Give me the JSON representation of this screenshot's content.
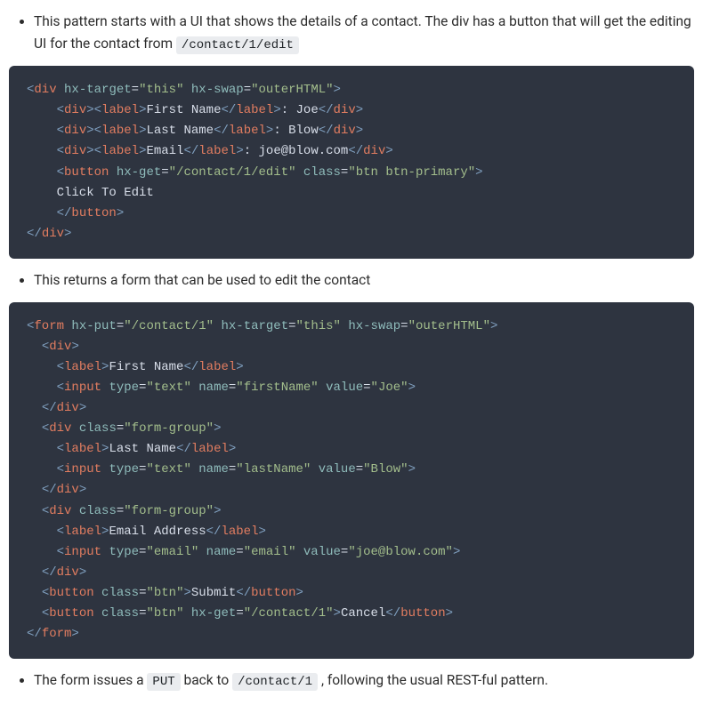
{
  "bullets": {
    "b1_a": "This pattern starts with a UI that shows the details of a contact. The div has a button that will get the editing UI for the contact from ",
    "b1_code": "/contact/1/edit",
    "b2": "This returns a form that can be used to edit the contact",
    "b3_a": "The form issues a ",
    "b3_code1": "PUT",
    "b3_b": " back to ",
    "b3_code2": "/contact/1",
    "b3_c": " , following the usual REST-ful pattern."
  },
  "code1": {
    "lines": [
      [
        {
          "c": "t-tag",
          "t": "<"
        },
        {
          "c": "t-name",
          "t": "div"
        },
        {
          "c": "t-txt",
          "t": " "
        },
        {
          "c": "t-attr",
          "t": "hx-target"
        },
        {
          "c": "t-op",
          "t": "="
        },
        {
          "c": "t-str",
          "t": "\"this\""
        },
        {
          "c": "t-txt",
          "t": " "
        },
        {
          "c": "t-attr",
          "t": "hx-swap"
        },
        {
          "c": "t-op",
          "t": "="
        },
        {
          "c": "t-str",
          "t": "\"outerHTML\""
        },
        {
          "c": "t-tag",
          "t": ">"
        }
      ],
      [
        {
          "c": "t-txt",
          "t": "    "
        },
        {
          "c": "t-tag",
          "t": "<"
        },
        {
          "c": "t-name",
          "t": "div"
        },
        {
          "c": "t-tag",
          "t": ">"
        },
        {
          "c": "t-tag",
          "t": "<"
        },
        {
          "c": "t-name",
          "t": "label"
        },
        {
          "c": "t-tag",
          "t": ">"
        },
        {
          "c": "t-txt",
          "t": "First Name"
        },
        {
          "c": "t-tag",
          "t": "</"
        },
        {
          "c": "t-name",
          "t": "label"
        },
        {
          "c": "t-tag",
          "t": ">"
        },
        {
          "c": "t-txt",
          "t": ": Joe"
        },
        {
          "c": "t-tag",
          "t": "</"
        },
        {
          "c": "t-name",
          "t": "div"
        },
        {
          "c": "t-tag",
          "t": ">"
        }
      ],
      [
        {
          "c": "t-txt",
          "t": "    "
        },
        {
          "c": "t-tag",
          "t": "<"
        },
        {
          "c": "t-name",
          "t": "div"
        },
        {
          "c": "t-tag",
          "t": ">"
        },
        {
          "c": "t-tag",
          "t": "<"
        },
        {
          "c": "t-name",
          "t": "label"
        },
        {
          "c": "t-tag",
          "t": ">"
        },
        {
          "c": "t-txt",
          "t": "Last Name"
        },
        {
          "c": "t-tag",
          "t": "</"
        },
        {
          "c": "t-name",
          "t": "label"
        },
        {
          "c": "t-tag",
          "t": ">"
        },
        {
          "c": "t-txt",
          "t": ": Blow"
        },
        {
          "c": "t-tag",
          "t": "</"
        },
        {
          "c": "t-name",
          "t": "div"
        },
        {
          "c": "t-tag",
          "t": ">"
        }
      ],
      [
        {
          "c": "t-txt",
          "t": "    "
        },
        {
          "c": "t-tag",
          "t": "<"
        },
        {
          "c": "t-name",
          "t": "div"
        },
        {
          "c": "t-tag",
          "t": ">"
        },
        {
          "c": "t-tag",
          "t": "<"
        },
        {
          "c": "t-name",
          "t": "label"
        },
        {
          "c": "t-tag",
          "t": ">"
        },
        {
          "c": "t-txt",
          "t": "Email"
        },
        {
          "c": "t-tag",
          "t": "</"
        },
        {
          "c": "t-name",
          "t": "label"
        },
        {
          "c": "t-tag",
          "t": ">"
        },
        {
          "c": "t-txt",
          "t": ": joe@blow.com"
        },
        {
          "c": "t-tag",
          "t": "</"
        },
        {
          "c": "t-name",
          "t": "div"
        },
        {
          "c": "t-tag",
          "t": ">"
        }
      ],
      [
        {
          "c": "t-txt",
          "t": "    "
        },
        {
          "c": "t-tag",
          "t": "<"
        },
        {
          "c": "t-name",
          "t": "button"
        },
        {
          "c": "t-txt",
          "t": " "
        },
        {
          "c": "t-attr",
          "t": "hx-get"
        },
        {
          "c": "t-op",
          "t": "="
        },
        {
          "c": "t-str",
          "t": "\"/contact/1/edit\""
        },
        {
          "c": "t-txt",
          "t": " "
        },
        {
          "c": "t-attr",
          "t": "class"
        },
        {
          "c": "t-op",
          "t": "="
        },
        {
          "c": "t-str",
          "t": "\"btn btn-primary\""
        },
        {
          "c": "t-tag",
          "t": ">"
        }
      ],
      [
        {
          "c": "t-txt",
          "t": "    Click To Edit"
        }
      ],
      [
        {
          "c": "t-txt",
          "t": "    "
        },
        {
          "c": "t-tag",
          "t": "</"
        },
        {
          "c": "t-name",
          "t": "button"
        },
        {
          "c": "t-tag",
          "t": ">"
        }
      ],
      [
        {
          "c": "t-tag",
          "t": "</"
        },
        {
          "c": "t-name",
          "t": "div"
        },
        {
          "c": "t-tag",
          "t": ">"
        }
      ]
    ]
  },
  "code2": {
    "lines": [
      [
        {
          "c": "t-tag",
          "t": "<"
        },
        {
          "c": "t-name",
          "t": "form"
        },
        {
          "c": "t-txt",
          "t": " "
        },
        {
          "c": "t-attr",
          "t": "hx-put"
        },
        {
          "c": "t-op",
          "t": "="
        },
        {
          "c": "t-str",
          "t": "\"/contact/1\""
        },
        {
          "c": "t-txt",
          "t": " "
        },
        {
          "c": "t-attr",
          "t": "hx-target"
        },
        {
          "c": "t-op",
          "t": "="
        },
        {
          "c": "t-str",
          "t": "\"this\""
        },
        {
          "c": "t-txt",
          "t": " "
        },
        {
          "c": "t-attr",
          "t": "hx-swap"
        },
        {
          "c": "t-op",
          "t": "="
        },
        {
          "c": "t-str",
          "t": "\"outerHTML\""
        },
        {
          "c": "t-tag",
          "t": ">"
        }
      ],
      [
        {
          "c": "t-txt",
          "t": "  "
        },
        {
          "c": "t-tag",
          "t": "<"
        },
        {
          "c": "t-name",
          "t": "div"
        },
        {
          "c": "t-tag",
          "t": ">"
        }
      ],
      [
        {
          "c": "t-txt",
          "t": "    "
        },
        {
          "c": "t-tag",
          "t": "<"
        },
        {
          "c": "t-name",
          "t": "label"
        },
        {
          "c": "t-tag",
          "t": ">"
        },
        {
          "c": "t-txt",
          "t": "First Name"
        },
        {
          "c": "t-tag",
          "t": "</"
        },
        {
          "c": "t-name",
          "t": "label"
        },
        {
          "c": "t-tag",
          "t": ">"
        }
      ],
      [
        {
          "c": "t-txt",
          "t": "    "
        },
        {
          "c": "t-tag",
          "t": "<"
        },
        {
          "c": "t-name",
          "t": "input"
        },
        {
          "c": "t-txt",
          "t": " "
        },
        {
          "c": "t-attr",
          "t": "type"
        },
        {
          "c": "t-op",
          "t": "="
        },
        {
          "c": "t-str",
          "t": "\"text\""
        },
        {
          "c": "t-txt",
          "t": " "
        },
        {
          "c": "t-attr",
          "t": "name"
        },
        {
          "c": "t-op",
          "t": "="
        },
        {
          "c": "t-str",
          "t": "\"firstName\""
        },
        {
          "c": "t-txt",
          "t": " "
        },
        {
          "c": "t-attr",
          "t": "value"
        },
        {
          "c": "t-op",
          "t": "="
        },
        {
          "c": "t-str",
          "t": "\"Joe\""
        },
        {
          "c": "t-tag",
          "t": ">"
        }
      ],
      [
        {
          "c": "t-txt",
          "t": "  "
        },
        {
          "c": "t-tag",
          "t": "</"
        },
        {
          "c": "t-name",
          "t": "div"
        },
        {
          "c": "t-tag",
          "t": ">"
        }
      ],
      [
        {
          "c": "t-txt",
          "t": "  "
        },
        {
          "c": "t-tag",
          "t": "<"
        },
        {
          "c": "t-name",
          "t": "div"
        },
        {
          "c": "t-txt",
          "t": " "
        },
        {
          "c": "t-attr",
          "t": "class"
        },
        {
          "c": "t-op",
          "t": "="
        },
        {
          "c": "t-str",
          "t": "\"form-group\""
        },
        {
          "c": "t-tag",
          "t": ">"
        }
      ],
      [
        {
          "c": "t-txt",
          "t": "    "
        },
        {
          "c": "t-tag",
          "t": "<"
        },
        {
          "c": "t-name",
          "t": "label"
        },
        {
          "c": "t-tag",
          "t": ">"
        },
        {
          "c": "t-txt",
          "t": "Last Name"
        },
        {
          "c": "t-tag",
          "t": "</"
        },
        {
          "c": "t-name",
          "t": "label"
        },
        {
          "c": "t-tag",
          "t": ">"
        }
      ],
      [
        {
          "c": "t-txt",
          "t": "    "
        },
        {
          "c": "t-tag",
          "t": "<"
        },
        {
          "c": "t-name",
          "t": "input"
        },
        {
          "c": "t-txt",
          "t": " "
        },
        {
          "c": "t-attr",
          "t": "type"
        },
        {
          "c": "t-op",
          "t": "="
        },
        {
          "c": "t-str",
          "t": "\"text\""
        },
        {
          "c": "t-txt",
          "t": " "
        },
        {
          "c": "t-attr",
          "t": "name"
        },
        {
          "c": "t-op",
          "t": "="
        },
        {
          "c": "t-str",
          "t": "\"lastName\""
        },
        {
          "c": "t-txt",
          "t": " "
        },
        {
          "c": "t-attr",
          "t": "value"
        },
        {
          "c": "t-op",
          "t": "="
        },
        {
          "c": "t-str",
          "t": "\"Blow\""
        },
        {
          "c": "t-tag",
          "t": ">"
        }
      ],
      [
        {
          "c": "t-txt",
          "t": "  "
        },
        {
          "c": "t-tag",
          "t": "</"
        },
        {
          "c": "t-name",
          "t": "div"
        },
        {
          "c": "t-tag",
          "t": ">"
        }
      ],
      [
        {
          "c": "t-txt",
          "t": "  "
        },
        {
          "c": "t-tag",
          "t": "<"
        },
        {
          "c": "t-name",
          "t": "div"
        },
        {
          "c": "t-txt",
          "t": " "
        },
        {
          "c": "t-attr",
          "t": "class"
        },
        {
          "c": "t-op",
          "t": "="
        },
        {
          "c": "t-str",
          "t": "\"form-group\""
        },
        {
          "c": "t-tag",
          "t": ">"
        }
      ],
      [
        {
          "c": "t-txt",
          "t": "    "
        },
        {
          "c": "t-tag",
          "t": "<"
        },
        {
          "c": "t-name",
          "t": "label"
        },
        {
          "c": "t-tag",
          "t": ">"
        },
        {
          "c": "t-txt",
          "t": "Email Address"
        },
        {
          "c": "t-tag",
          "t": "</"
        },
        {
          "c": "t-name",
          "t": "label"
        },
        {
          "c": "t-tag",
          "t": ">"
        }
      ],
      [
        {
          "c": "t-txt",
          "t": "    "
        },
        {
          "c": "t-tag",
          "t": "<"
        },
        {
          "c": "t-name",
          "t": "input"
        },
        {
          "c": "t-txt",
          "t": " "
        },
        {
          "c": "t-attr",
          "t": "type"
        },
        {
          "c": "t-op",
          "t": "="
        },
        {
          "c": "t-str",
          "t": "\"email\""
        },
        {
          "c": "t-txt",
          "t": " "
        },
        {
          "c": "t-attr",
          "t": "name"
        },
        {
          "c": "t-op",
          "t": "="
        },
        {
          "c": "t-str",
          "t": "\"email\""
        },
        {
          "c": "t-txt",
          "t": " "
        },
        {
          "c": "t-attr",
          "t": "value"
        },
        {
          "c": "t-op",
          "t": "="
        },
        {
          "c": "t-str",
          "t": "\"joe@blow.com\""
        },
        {
          "c": "t-tag",
          "t": ">"
        }
      ],
      [
        {
          "c": "t-txt",
          "t": "  "
        },
        {
          "c": "t-tag",
          "t": "</"
        },
        {
          "c": "t-name",
          "t": "div"
        },
        {
          "c": "t-tag",
          "t": ">"
        }
      ],
      [
        {
          "c": "t-txt",
          "t": "  "
        },
        {
          "c": "t-tag",
          "t": "<"
        },
        {
          "c": "t-name",
          "t": "button"
        },
        {
          "c": "t-txt",
          "t": " "
        },
        {
          "c": "t-attr",
          "t": "class"
        },
        {
          "c": "t-op",
          "t": "="
        },
        {
          "c": "t-str",
          "t": "\"btn\""
        },
        {
          "c": "t-tag",
          "t": ">"
        },
        {
          "c": "t-txt",
          "t": "Submit"
        },
        {
          "c": "t-tag",
          "t": "</"
        },
        {
          "c": "t-name",
          "t": "button"
        },
        {
          "c": "t-tag",
          "t": ">"
        }
      ],
      [
        {
          "c": "t-txt",
          "t": "  "
        },
        {
          "c": "t-tag",
          "t": "<"
        },
        {
          "c": "t-name",
          "t": "button"
        },
        {
          "c": "t-txt",
          "t": " "
        },
        {
          "c": "t-attr",
          "t": "class"
        },
        {
          "c": "t-op",
          "t": "="
        },
        {
          "c": "t-str",
          "t": "\"btn\""
        },
        {
          "c": "t-txt",
          "t": " "
        },
        {
          "c": "t-attr",
          "t": "hx-get"
        },
        {
          "c": "t-op",
          "t": "="
        },
        {
          "c": "t-str",
          "t": "\"/contact/1\""
        },
        {
          "c": "t-tag",
          "t": ">"
        },
        {
          "c": "t-txt",
          "t": "Cancel"
        },
        {
          "c": "t-tag",
          "t": "</"
        },
        {
          "c": "t-name",
          "t": "button"
        },
        {
          "c": "t-tag",
          "t": ">"
        }
      ],
      [
        {
          "c": "t-tag",
          "t": "</"
        },
        {
          "c": "t-name",
          "t": "form"
        },
        {
          "c": "t-tag",
          "t": ">"
        }
      ]
    ]
  }
}
